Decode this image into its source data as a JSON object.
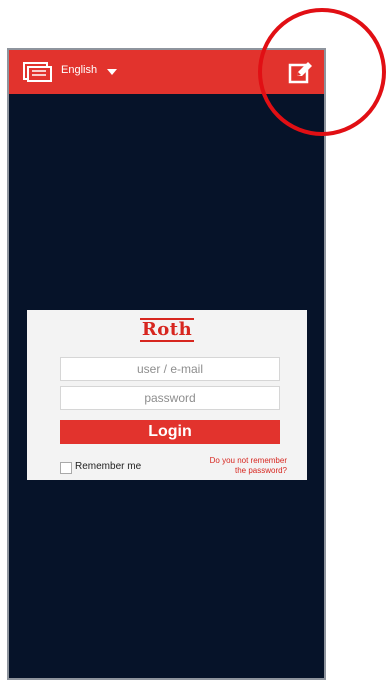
{
  "topbar": {
    "language": "English",
    "language_icon": "language-icon",
    "caret_icon": "chevron-down-icon",
    "edit_icon": "edit-icon",
    "bar_color": "#e2332d"
  },
  "login": {
    "brand": "Roth",
    "user_placeholder": "user / e-mail",
    "password_placeholder": "password",
    "login_label": "Login",
    "remember_label": "Remember me",
    "forgot_line1": "Do you not remember",
    "forgot_line2": "the password?"
  },
  "annotation": {
    "circle_color": "#e10f14"
  },
  "colors": {
    "background": "#061329",
    "accent": "#e2332d"
  }
}
